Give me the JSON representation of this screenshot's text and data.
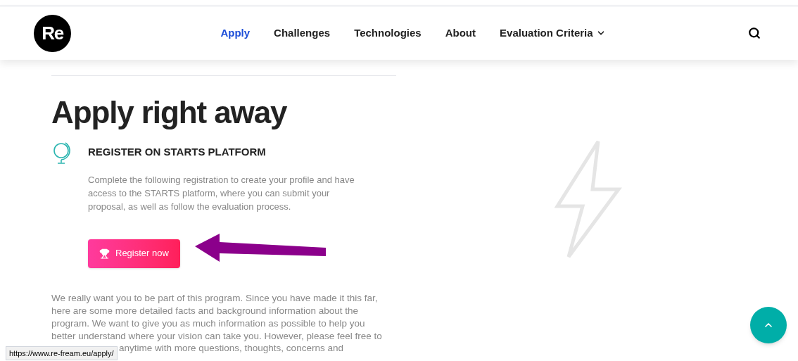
{
  "header": {
    "logo": "Re",
    "nav": [
      {
        "label": "Apply",
        "selected": true,
        "dropdown": false
      },
      {
        "label": "Challenges",
        "selected": false,
        "dropdown": false
      },
      {
        "label": "Technologies",
        "selected": false,
        "dropdown": false
      },
      {
        "label": "About",
        "selected": false,
        "dropdown": false
      },
      {
        "label": "Evaluation Criteria",
        "selected": false,
        "dropdown": true
      }
    ]
  },
  "main": {
    "heading": "Apply right away",
    "step": {
      "title": "REGISTER ON STARTS PLATFORM",
      "description": "Complete the following registration to create your profile and have access to the STARTS platform, where you can submit your proposal, as well as follow the evaluation process.",
      "button": "Register now"
    },
    "paragraph": "We really want you to be part of this program. Since you have made it this far, here are some more detailed facts and background information about the program. We want to give you as much information as possible to help you better understand where your vision can take you. However, please feel free to",
    "paragraph_cut": "anytime with more questions, thoughts, concerns and"
  },
  "status_bar": {
    "url": "https://www.re-fream.eu/apply/"
  }
}
